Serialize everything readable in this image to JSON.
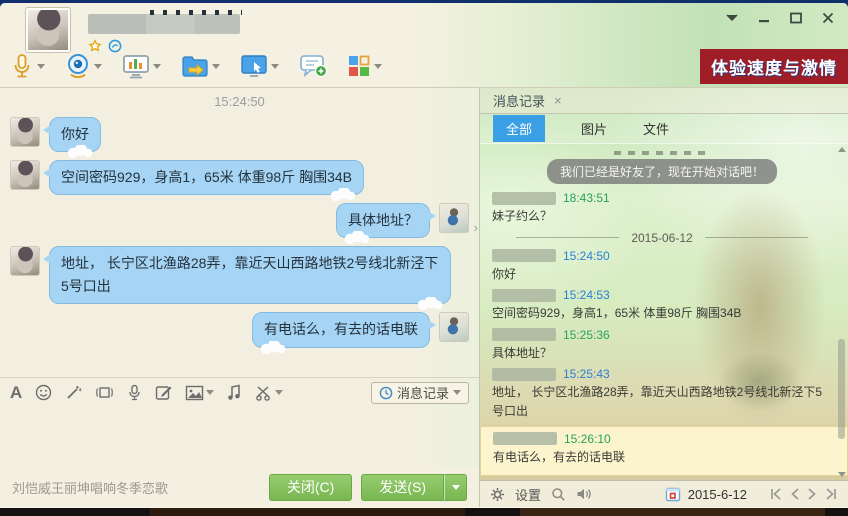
{
  "window_controls": {
    "icons": [
      "menu-down-icon",
      "minimize-icon",
      "maximize-icon",
      "close-icon"
    ]
  },
  "header": {
    "banner_text": "体验速度与激情",
    "badge_icons": [
      "star-icon",
      "qzone-icon"
    ],
    "toolbar_icons": [
      "microphone-icon",
      "video-call-icon",
      "screen-demo-icon",
      "send-file-icon",
      "remote-desktop-icon",
      "group-chat-icon",
      "apps-grid-icon"
    ]
  },
  "chat": {
    "session_time": "15:24:50",
    "messages": [
      {
        "side": "left",
        "text": "你好"
      },
      {
        "side": "left",
        "text": "空间密码929，身高1，65米 体重98斤 胸围34B"
      },
      {
        "side": "right",
        "text": "具体地址？"
      },
      {
        "side": "left",
        "text": "地址，  长宁区北渔路28弄，靠近天山西路地铁2号线北新泾下5号口出"
      },
      {
        "side": "right",
        "text": "有电话么，有去的话电联"
      }
    ]
  },
  "input_toolbar": {
    "icons": [
      "font-icon",
      "emoticon-icon",
      "magic-wand-icon",
      "window-shake-icon",
      "voice-record-icon",
      "compose-icon",
      "image-icon",
      "music-icon",
      "screenshot-icon"
    ],
    "history_button_label": "消息记录"
  },
  "footer": {
    "news_ticker": "刘恺威王丽坤唱响冬季恋歌",
    "close_button": "关闭(C)",
    "send_button": "发送(S)"
  },
  "history": {
    "tab_title": "消息记录",
    "tab_close": "×",
    "tabs": [
      "全部",
      "图片",
      "文件"
    ],
    "active_tab": "全部",
    "notice": "我们已经是好友了，现在开始对话吧！",
    "entries": [
      {
        "type": "message",
        "time": "18:43:51",
        "time_color": "green",
        "text": "妹子约么？"
      },
      {
        "type": "divider",
        "label": "2015-06-12"
      },
      {
        "type": "message",
        "time": "15:24:50",
        "time_color": "blue",
        "text": "你好"
      },
      {
        "type": "message",
        "time": "15:24:53",
        "time_color": "blue",
        "text": "空间密码929，身高1，65米 体重98斤 胸围34B"
      },
      {
        "type": "message",
        "time": "15:25:36",
        "time_color": "green",
        "text": "具体地址？"
      },
      {
        "type": "message",
        "time": "15:25:43",
        "time_color": "blue",
        "text": "地址，  长宁区北渔路28弄，靠近天山西路地铁2号线北新泾下5号口出"
      },
      {
        "type": "message",
        "time": "15:26:10",
        "time_color": "green",
        "text": "有电话么，有去的话电联",
        "highlight": true
      }
    ],
    "panel_footer": {
      "settings_label": "设置",
      "date": "2015-6-12",
      "icons": [
        "gear-icon",
        "search-icon",
        "speaker-icon",
        "calendar-icon",
        "first-page-icon",
        "prev-page-icon",
        "next-page-icon",
        "last-page-icon"
      ]
    }
  },
  "colors": {
    "accent_blue": "#3b9fe6",
    "bubble_blue": "#a6d4f4",
    "button_green": "#79b651",
    "time_blue": "#2a7fd4",
    "time_green": "#27a35c",
    "banner_red": "#9e1d26",
    "highlight_yellow": "#fcf4cd"
  }
}
